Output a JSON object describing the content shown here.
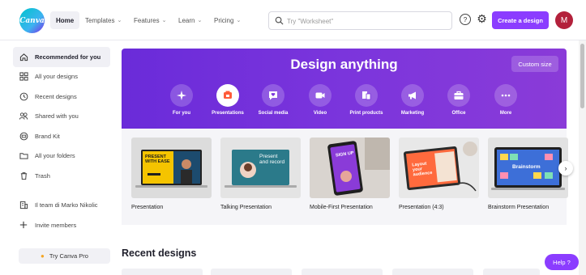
{
  "header": {
    "logo_text": "Canva",
    "nav": [
      {
        "label": "Home"
      },
      {
        "label": "Templates"
      },
      {
        "label": "Features"
      },
      {
        "label": "Learn"
      },
      {
        "label": "Pricing"
      }
    ],
    "search_placeholder": "Try \"Worksheet\"",
    "help_icon_text": "?",
    "create_button": "Create a design",
    "avatar_initial": "M",
    "accent": "#8b3dff"
  },
  "sidebar": {
    "items": [
      {
        "label": "Recommended for you",
        "icon": "home-icon"
      },
      {
        "label": "All your designs",
        "icon": "grid-icon"
      },
      {
        "label": "Recent designs",
        "icon": "clock-icon"
      },
      {
        "label": "Shared with you",
        "icon": "people-icon"
      },
      {
        "label": "Brand Kit",
        "icon": "brand-icon"
      },
      {
        "label": "All your folders",
        "icon": "folder-icon"
      },
      {
        "label": "Trash",
        "icon": "trash-icon"
      }
    ],
    "team_items": [
      {
        "label": "Il team di Marko Nikolic",
        "icon": "building-icon"
      },
      {
        "label": "Invite members",
        "icon": "plus-icon"
      }
    ],
    "try_pro": "Try Canva Pro"
  },
  "banner": {
    "title": "Design anything",
    "custom_size": "Custom size",
    "categories": [
      {
        "label": "For you",
        "icon": "sparkle-icon"
      },
      {
        "label": "Presentations",
        "icon": "presentation-icon"
      },
      {
        "label": "Social media",
        "icon": "heart-chat-icon"
      },
      {
        "label": "Video",
        "icon": "video-icon"
      },
      {
        "label": "Print products",
        "icon": "print-icon"
      },
      {
        "label": "Marketing",
        "icon": "megaphone-icon"
      },
      {
        "label": "Office",
        "icon": "briefcase-icon"
      },
      {
        "label": "More",
        "icon": "more-icon"
      }
    ]
  },
  "templates": [
    {
      "caption": "Presentation",
      "thumb_text": "PRESENT WITH EASE"
    },
    {
      "caption": "Talking Presentation",
      "thumb_text": "Present and record"
    },
    {
      "caption": "Mobile-First Presentation",
      "thumb_text": "SIGN UP"
    },
    {
      "caption": "Presentation (4:3)",
      "thumb_text": "Layout your audience"
    },
    {
      "caption": "Brainstorm Presentation",
      "thumb_text": "Brainstorm"
    }
  ],
  "recent": {
    "title": "Recent designs"
  },
  "help_button": "Help ?"
}
